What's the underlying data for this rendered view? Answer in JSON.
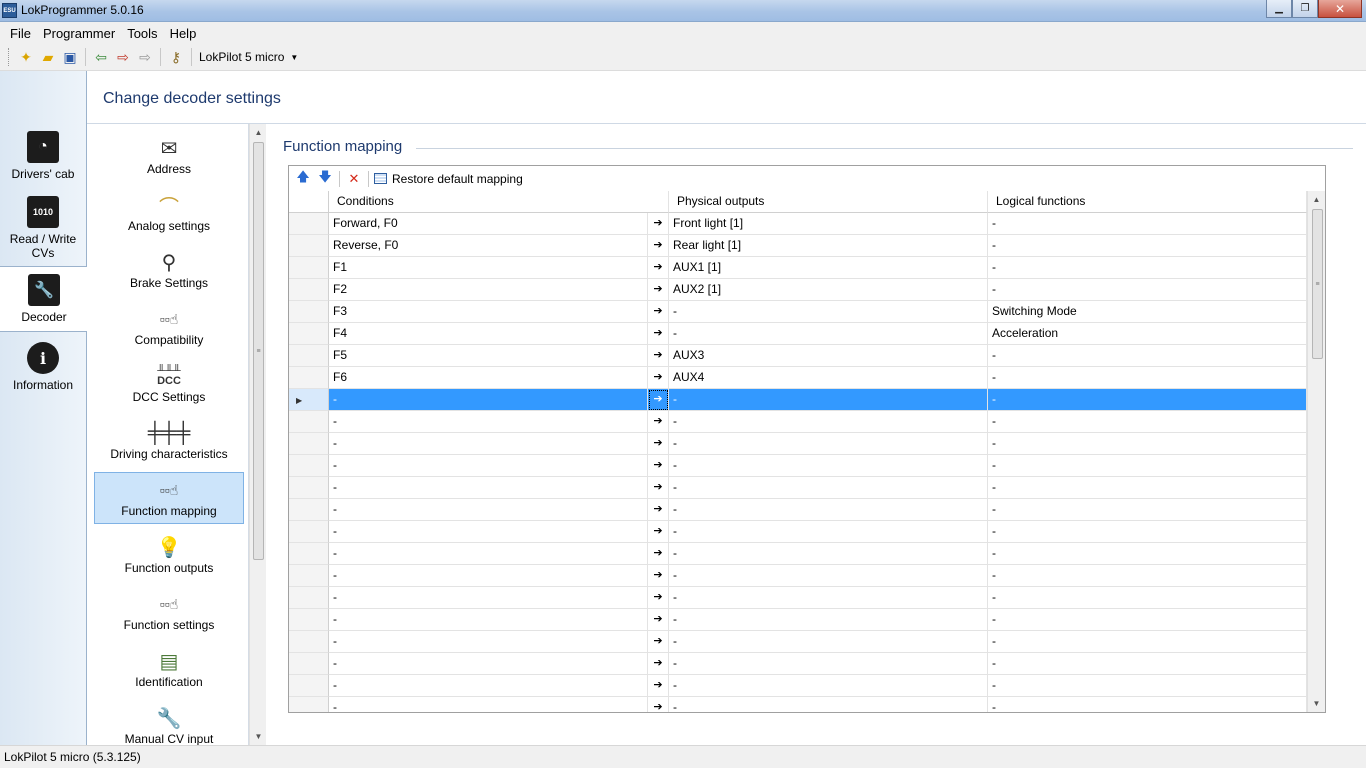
{
  "window": {
    "title": "LokProgrammer 5.0.16",
    "app_icon_text": "ESU"
  },
  "menu": [
    {
      "label": "File"
    },
    {
      "label": "Programmer"
    },
    {
      "label": "Tools"
    },
    {
      "label": "Help"
    }
  ],
  "toolbar": {
    "decoder_select": "LokPilot 5 micro"
  },
  "nav": [
    {
      "label": "Drivers' cab",
      "icon": "drivers-cab-icon"
    },
    {
      "label": "Read / Write CVs",
      "icon": "read-write-cv-icon"
    },
    {
      "label": "Decoder",
      "icon": "wrench-icon"
    },
    {
      "label": "Information",
      "icon": "info-icon"
    }
  ],
  "header": {
    "title": "Change decoder settings"
  },
  "categories": [
    {
      "label": "Address",
      "icon": "envelope-icon"
    },
    {
      "label": "Analog settings",
      "icon": "analog-icon"
    },
    {
      "label": "Brake Settings",
      "icon": "brake-lever-icon"
    },
    {
      "label": "Compatibility",
      "icon": "hand-switch-icon"
    },
    {
      "label": "DCC Settings",
      "icon": "dcc-icon",
      "icon_text": "DCC"
    },
    {
      "label": "Driving characteristics",
      "icon": "sliders-icon"
    },
    {
      "label": "Function mapping",
      "icon": "hand-switch-icon"
    },
    {
      "label": "Function outputs",
      "icon": "light-bulb-icon"
    },
    {
      "label": "Function settings",
      "icon": "hand-switch-icon"
    },
    {
      "label": "Identification",
      "icon": "id-card-icon"
    },
    {
      "label": "Manual CV input",
      "icon": "wrench-cv-icon"
    }
  ],
  "function_mapping": {
    "section_title": "Function mapping",
    "toolbar": {
      "restore_label": "Restore default mapping"
    },
    "columns": {
      "conditions": "Conditions",
      "physical": "Physical outputs",
      "logical": "Logical functions"
    },
    "rows": [
      {
        "conditions": "Forward, F0",
        "physical": "Front light [1]",
        "logical": "-"
      },
      {
        "conditions": "Reverse, F0",
        "physical": "Rear light [1]",
        "logical": "-"
      },
      {
        "conditions": "F1",
        "physical": "AUX1 [1]",
        "logical": "-"
      },
      {
        "conditions": "F2",
        "physical": "AUX2 [1]",
        "logical": "-"
      },
      {
        "conditions": "F3",
        "physical": "-",
        "logical": "Switching Mode"
      },
      {
        "conditions": "F4",
        "physical": "-",
        "logical": "Acceleration"
      },
      {
        "conditions": "F5",
        "physical": "AUX3",
        "logical": "-"
      },
      {
        "conditions": "F6",
        "physical": "AUX4",
        "logical": "-"
      },
      {
        "conditions": "-",
        "physical": "-",
        "logical": "-",
        "selected": true
      },
      {
        "conditions": "-",
        "physical": "-",
        "logical": "-"
      },
      {
        "conditions": "-",
        "physical": "-",
        "logical": "-"
      },
      {
        "conditions": "-",
        "physical": "-",
        "logical": "-"
      },
      {
        "conditions": "-",
        "physical": "-",
        "logical": "-"
      },
      {
        "conditions": "-",
        "physical": "-",
        "logical": "-"
      },
      {
        "conditions": "-",
        "physical": "-",
        "logical": "-"
      },
      {
        "conditions": "-",
        "physical": "-",
        "logical": "-"
      },
      {
        "conditions": "-",
        "physical": "-",
        "logical": "-"
      },
      {
        "conditions": "-",
        "physical": "-",
        "logical": "-"
      },
      {
        "conditions": "-",
        "physical": "-",
        "logical": "-"
      },
      {
        "conditions": "-",
        "physical": "-",
        "logical": "-"
      },
      {
        "conditions": "-",
        "physical": "-",
        "logical": "-"
      },
      {
        "conditions": "-",
        "physical": "-",
        "logical": "-"
      },
      {
        "conditions": "-",
        "physical": "-",
        "logical": "-"
      }
    ]
  },
  "status": {
    "text": "LokPilot 5 micro (5.3.125)"
  },
  "colors": {
    "selection": "#3399ff",
    "title_blue": "#1e3a6e"
  }
}
